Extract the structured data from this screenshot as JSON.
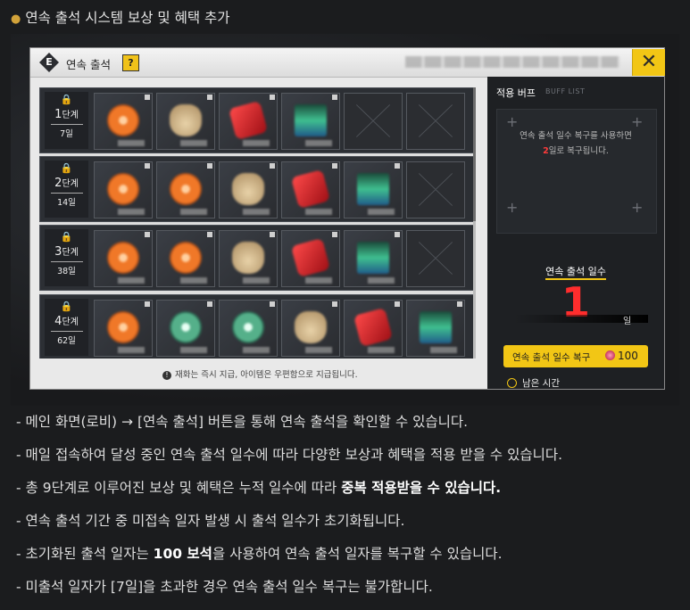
{
  "heading": "연속 출석 시스템 보상 및 혜택 추가",
  "panel": {
    "badge": "E",
    "title": "연속 출석",
    "help": "?",
    "close": "✕"
  },
  "rows": [
    {
      "lock": "🔒",
      "stage": "1",
      "stage_unit": "단계",
      "days": "7일",
      "items": [
        "orange",
        "sack",
        "red",
        "card",
        "empty",
        "empty"
      ]
    },
    {
      "lock": "🔒",
      "stage": "2",
      "stage_unit": "단계",
      "days": "14일",
      "items": [
        "orange",
        "orange",
        "sack",
        "red",
        "card",
        "empty"
      ]
    },
    {
      "lock": "🔒",
      "stage": "3",
      "stage_unit": "단계",
      "days": "38일",
      "items": [
        "orange",
        "orange",
        "sack",
        "red",
        "card",
        "empty"
      ]
    },
    {
      "lock": "🔒",
      "stage": "4",
      "stage_unit": "단계",
      "days": "62일",
      "items": [
        "orange",
        "green",
        "green",
        "sack",
        "red",
        "card"
      ]
    }
  ],
  "notice": "재화는 즉시 지급, 아이템은 우편함으로 지급됩니다.",
  "side": {
    "buff_title": "적용 버프",
    "buff_sub": "BUFF LIST",
    "desc_line1": "연속 출석 일수 복구를 사용하면",
    "desc_num": "2",
    "desc_line2_rest": "일로 복구됩니다.",
    "days_label": "연속 출석 일수",
    "days_value": "1",
    "days_unit": "일",
    "restore_label": "연속 출석 일수 복구",
    "restore_cost": "100",
    "remain_label": "남은 시간"
  },
  "info": [
    "- 메인 화면(로비) → [연속 출석] 버튼을 통해 연속 출석을 확인할 수 있습니다.",
    "- 매일 접속하여 달성 중인 연속 출석 일수에 따라 다양한 보상과 혜택을 적용 받을 수 있습니다.",
    "- 총 9단계로 이루어진 보상 및 혜택은 누적 일수에 따라 ",
    "중복 적용받을 수 있습니다.",
    "- 연속 출석 기간 중 미접속 일자 발생 시 출석 일수가 초기화됩니다.",
    "- 초기화된 출석 일자는 ",
    "100 보석",
    "을 사용하여 연속 출석 일자를 복구할 수 있습니다.",
    "- 미출석 일자가 [7일]을 초과한 경우 연속 출석 일수 복구는 불가합니다."
  ],
  "colors": {
    "accent": "#f2c615",
    "highlight": "#ff2d2d"
  }
}
